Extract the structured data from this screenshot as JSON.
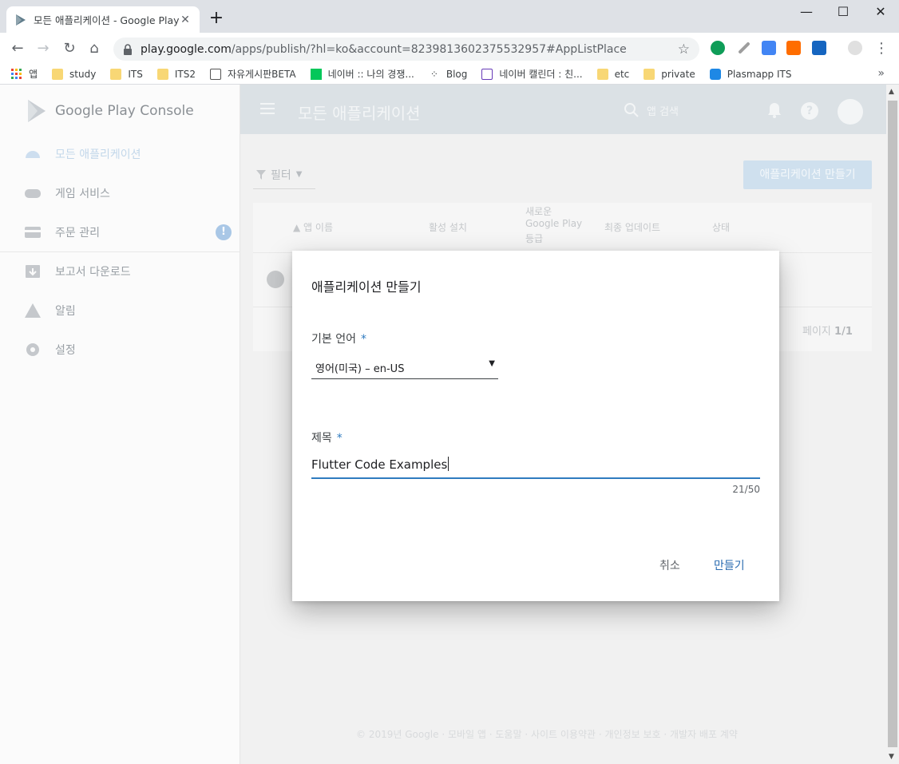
{
  "browser": {
    "tab_title": "모든 애플리케이션 - Google Play Console",
    "url_main": "play.google.com",
    "url_rest": "/apps/publish/?hl=ko&account=8239813602375532957#AppListPlace",
    "bookmarks": [
      {
        "label": "앱",
        "icon": "apps-grid-icon"
      },
      {
        "label": "study",
        "icon": "folder-icon"
      },
      {
        "label": "ITS",
        "icon": "folder-icon"
      },
      {
        "label": "ITS2",
        "icon": "folder-icon"
      },
      {
        "label": "자유게시판BETA",
        "icon": "site-icon"
      },
      {
        "label": "네이버 :: 나의 경쟁...",
        "icon": "naver-icon"
      },
      {
        "label": "Blog",
        "icon": "blog-icon"
      },
      {
        "label": "네이버 캘린더 : 친...",
        "icon": "calendar-icon"
      },
      {
        "label": "etc",
        "icon": "folder-icon"
      },
      {
        "label": "private",
        "icon": "folder-icon"
      },
      {
        "label": "Plasmapp ITS",
        "icon": "site-icon"
      }
    ],
    "bookmarks_overflow": "»"
  },
  "console": {
    "brand": "Google Play Console",
    "nav": [
      {
        "label": "모든 애플리케이션",
        "icon": "android-icon"
      },
      {
        "label": "게임 서비스",
        "icon": "gamepad-icon"
      },
      {
        "label": "주문 관리",
        "icon": "credit-card-icon"
      },
      {
        "label": "보고서 다운로드",
        "icon": "download-box-icon"
      },
      {
        "label": "알림",
        "icon": "warning-icon"
      },
      {
        "label": "설정",
        "icon": "gear-icon"
      }
    ],
    "nav_badge": "!",
    "appbar_title": "모든 애플리케이션",
    "search_placeholder": "앱 검색",
    "help_label": "?",
    "filter_label": "필터",
    "create_app_button": "애플리케이션 만들기",
    "columns": {
      "app_name": "▲ 앱 이름",
      "active_installs": "활성 설치",
      "new_rating_line1": "새로운",
      "new_rating_line2": "Google Play",
      "new_rating_line3": "등급",
      "last_update": "최종 업데이트",
      "status": "상태"
    },
    "pagination_prefix": "페이지",
    "pagination_value": "1/1",
    "footer": "© 2019년 Google · 모바일 앱 · 도움말 · 사이트 이용약관 · 개인정보 보호 · 개발자 배포 계약"
  },
  "dialog": {
    "title": "애플리케이션 만들기",
    "language_label": "기본 언어",
    "language_value": "영어(미국) – en-US",
    "required_mark": "*",
    "title_label": "제목",
    "title_value": "Flutter Code Examples",
    "char_counter": "21/50",
    "cancel_button": "취소",
    "create_button": "만들기"
  },
  "colors": {
    "accent": "#2f7bbf",
    "appbar": "#dbe1e5",
    "overlay_bg": "#f1f1f1"
  }
}
